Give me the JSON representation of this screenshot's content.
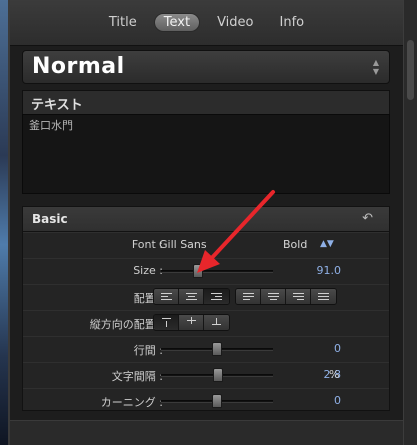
{
  "tabs": [
    "Title",
    "Text",
    "Video",
    "Info"
  ],
  "active_tab": "Text",
  "preset": {
    "name": "Normal"
  },
  "text_box": {
    "title": "テキスト",
    "value": "釜口水門"
  },
  "basic": {
    "title": "Basic",
    "font": {
      "label": "Font :",
      "family": "Gill Sans",
      "style": "Bold"
    },
    "size": {
      "label": "Size :",
      "value": "91.0",
      "level": 0.33
    },
    "alignment": {
      "label": "配置 :",
      "selected": "right",
      "selected_justify": "none"
    },
    "vertical_alignment": {
      "label": "縦方向の配置 :",
      "selected": "top"
    },
    "line_spacing": {
      "label": "行間 :",
      "value": "0",
      "level": 0.5
    },
    "tracking": {
      "label": "文字間隔 :",
      "value": "2.8",
      "unit": "%",
      "level": 0.51
    },
    "kerning": {
      "label": "カーニング :",
      "value": "0",
      "level": 0.5
    }
  },
  "annotation": {
    "color": "#e8262b"
  }
}
